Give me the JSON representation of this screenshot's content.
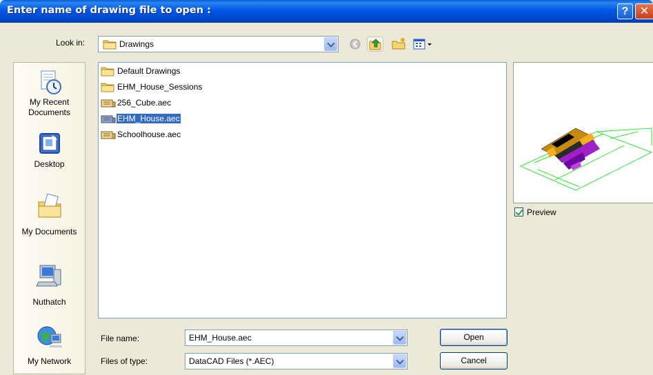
{
  "window": {
    "title": "Enter name of drawing file to open :"
  },
  "lookin": {
    "label": "Look in:",
    "value": "Drawings"
  },
  "places": [
    {
      "label": "My Recent Documents",
      "line1": "My Recent",
      "line2": "Documents"
    },
    {
      "label": "Desktop"
    },
    {
      "label": "My Documents"
    },
    {
      "label": "Nuthatch"
    },
    {
      "label": "My Network"
    }
  ],
  "files": [
    {
      "name": "Default Drawings",
      "kind": "folder"
    },
    {
      "name": "EHM_House_Sessions",
      "kind": "folder"
    },
    {
      "name": "256_Cube.aec",
      "kind": "aec"
    },
    {
      "name": "EHM_House.aec",
      "kind": "aec",
      "selected": true
    },
    {
      "name": "Schoolhouse.aec",
      "kind": "aec"
    }
  ],
  "preview": {
    "label": "Preview",
    "checked": true
  },
  "filename": {
    "label": "File name:",
    "value": "EHM_House.aec"
  },
  "filetype": {
    "label": "Files of type:",
    "value": "DataCAD Files (*.AEC)"
  },
  "buttons": {
    "open": "Open",
    "cancel": "Cancel"
  },
  "colors": {
    "titlebar": "#0058e6",
    "selection": "#316ac5",
    "dialog_bg": "#ece9d8"
  }
}
